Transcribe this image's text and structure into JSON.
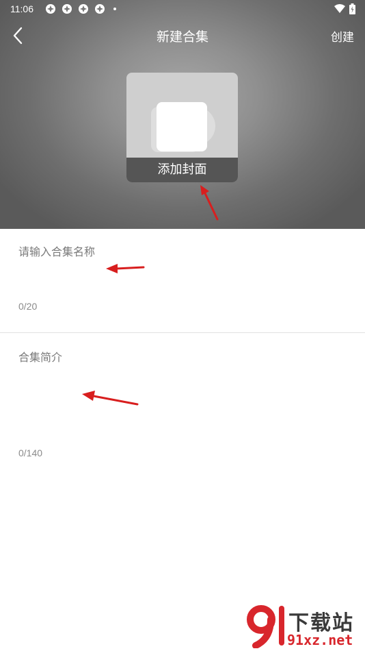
{
  "status_bar": {
    "time": "11:06",
    "notification_icons": [
      "aperture-icon",
      "aperture-icon",
      "aperture-icon",
      "aperture-icon"
    ],
    "right_icons": [
      "wifi-icon",
      "battery-icon"
    ]
  },
  "nav": {
    "back_icon": "chevron-left-icon",
    "title": "新建合集",
    "action_label": "创建"
  },
  "cover": {
    "label": "添加封面"
  },
  "name_field": {
    "placeholder": "请输入合集名称",
    "counter": "0/20"
  },
  "description_field": {
    "placeholder": "合集简介",
    "counter": "0/140"
  },
  "watermark": {
    "text_top": "下载站",
    "text_bottom": "91xz.net"
  },
  "colors": {
    "header_bg": "#8f8f8f",
    "annotation_arrow": "#d81e1e",
    "watermark_red": "#d8262c"
  }
}
